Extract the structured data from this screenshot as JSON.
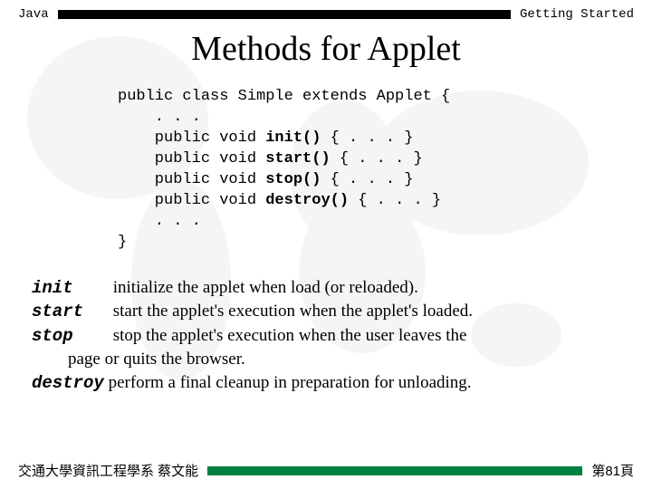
{
  "header": {
    "left": "Java",
    "right": "Getting Started"
  },
  "title": "Methods for Applet",
  "code": {
    "l1": "public class Simple extends Applet {",
    "l2": "    . . .",
    "l3a": "    public void ",
    "l3b": "init()",
    "l3c": " { . . . }",
    "l4a": "    public void ",
    "l4b": "start()",
    "l4c": " { . . . }",
    "l5a": "    public void ",
    "l5b": "stop()",
    "l5c": " { . . . }",
    "l6a": "    public void ",
    "l6b": "destroy()",
    "l6c": " { . . . }",
    "l7": "    . . .",
    "l8": "}"
  },
  "desc": {
    "init_term": "init",
    "init_text": "initialize the applet when load (or reloaded).",
    "start_term": "start",
    "start_text": "start the applet's execution when the applet's loaded.",
    "stop_term": "stop",
    "stop_text": "stop the applet's execution when the user leaves the",
    "stop_text2": "page or quits the browser.",
    "destroy_term": "destroy",
    "destroy_text": "perform a final cleanup in preparation for unloading."
  },
  "footer": {
    "left": "交通大學資訊工程學系 蔡文能",
    "right": "第81頁"
  }
}
